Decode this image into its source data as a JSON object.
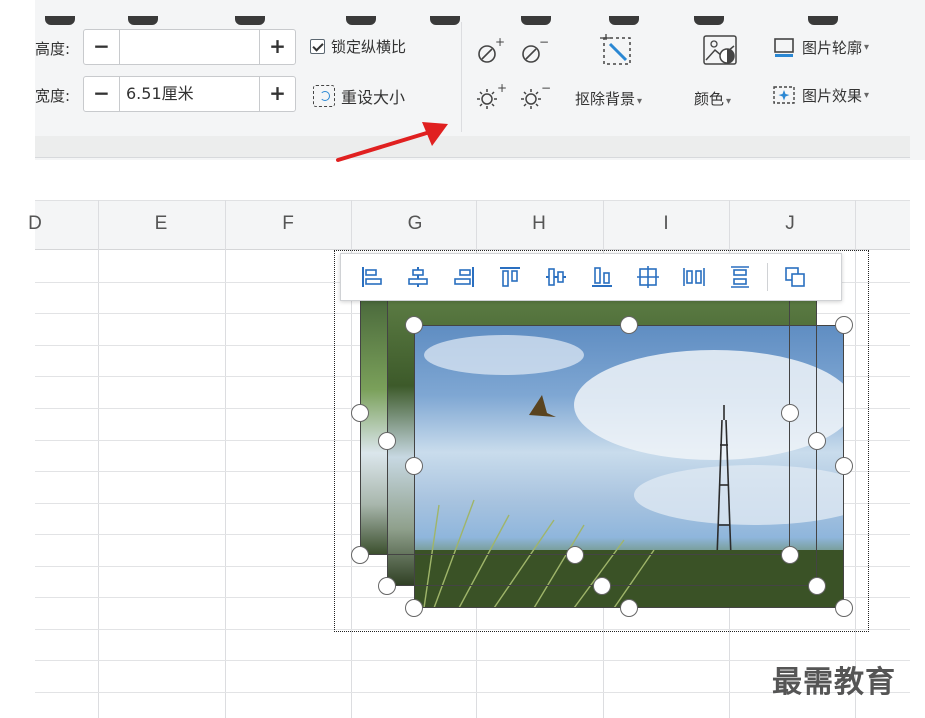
{
  "ribbon": {
    "height_label": "高度:",
    "width_label": "宽度:",
    "height_value": "",
    "width_value": "6.51厘米",
    "minus": "−",
    "plus": "+",
    "lock_ratio_label": "锁定纵横比",
    "lock_ratio_checked": true,
    "reset_size_label": "重设大小",
    "remove_bg_label": "抠除背景",
    "color_label": "颜色",
    "outline_label": "图片轮廓",
    "effects_label": "图片效果",
    "dropdown_caret": "▾"
  },
  "sheet": {
    "columns": [
      "D",
      "E",
      "F",
      "G",
      "H",
      "I",
      "J"
    ]
  },
  "align_toolbar": {
    "buttons": [
      "align-left",
      "align-center",
      "align-right",
      "align-top",
      "align-middle",
      "align-bottom",
      "center-both",
      "distribute-horizontal",
      "distribute-vertical",
      "group"
    ]
  },
  "annotation_color": "#e02020",
  "watermark": "最需教育"
}
